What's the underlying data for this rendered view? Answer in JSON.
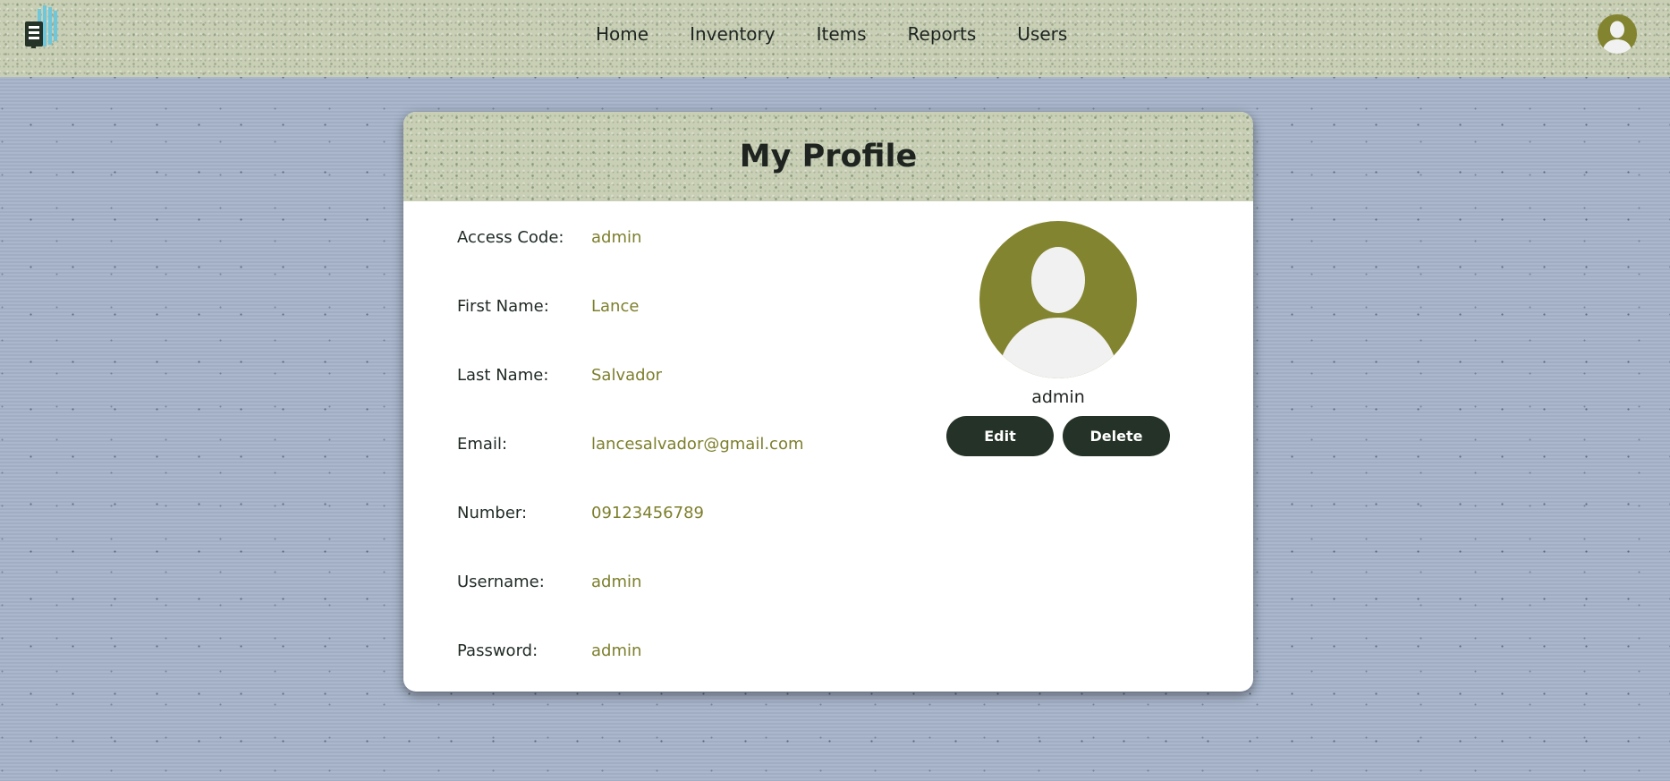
{
  "header": {
    "logo_icon": "building-logo-icon",
    "nav": [
      {
        "label": "Home"
      },
      {
        "label": "Inventory"
      },
      {
        "label": "Items"
      },
      {
        "label": "Reports"
      },
      {
        "label": "Users"
      }
    ],
    "avatar_icon": "user-avatar-icon"
  },
  "profile": {
    "title": "My Profile",
    "fields": [
      {
        "label": "Access Code:",
        "value": "admin"
      },
      {
        "label": "First Name:",
        "value": "Lance"
      },
      {
        "label": "Last Name:",
        "value": "Salvador"
      },
      {
        "label": "Email:",
        "value": "lancesalvador@gmail.com"
      },
      {
        "label": "Number:",
        "value": "09123456789"
      },
      {
        "label": "Username:",
        "value": "admin"
      },
      {
        "label": "Password:",
        "value": "admin"
      }
    ],
    "photo_icon": "profile-picture-icon",
    "username": "admin",
    "edit_label": "Edit",
    "delete_label": "Delete"
  },
  "colors": {
    "accent_olive": "#82842f",
    "value_text": "#7d7f2c",
    "button_dark": "#243227",
    "page_bg": "#a5b3c9",
    "header_bg": "#c8cfb5"
  }
}
